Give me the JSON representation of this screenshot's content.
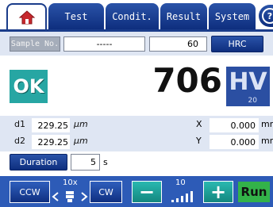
{
  "tabs": {
    "home_icon": "home-icon",
    "items": [
      {
        "label": "Test"
      },
      {
        "label": "Condit."
      },
      {
        "label": "Result"
      },
      {
        "label": "System"
      }
    ],
    "help_icon": "question-icon",
    "help_label": "?"
  },
  "sample": {
    "button_label": "Sample No.",
    "value": "-----",
    "load": "60",
    "scale_button": "HRC"
  },
  "result": {
    "status": "OK",
    "value": "706",
    "unit": "HV",
    "unit_sub": "20"
  },
  "measurements": {
    "d1_label": "d1",
    "d1_value": "229.25",
    "d1_unit": "μm",
    "d2_label": "d2",
    "d2_value": "229.25",
    "d2_unit": "μm",
    "x_label": "X",
    "x_value": "0.000",
    "x_unit": "mm",
    "y_label": "Y",
    "y_value": "0.000",
    "y_unit": "mm"
  },
  "duration": {
    "button_label": "Duration",
    "value": "5",
    "unit": "s"
  },
  "controls": {
    "ccw_label": "CCW",
    "position_label": "10x",
    "cw_label": "CW",
    "minus_label": "−",
    "speed_label": "10",
    "plus_label": "+",
    "run_label": "Run",
    "colors": {
      "teal": "#27a6a3",
      "blue": "#2d5bb7",
      "green": "#33b249"
    }
  }
}
